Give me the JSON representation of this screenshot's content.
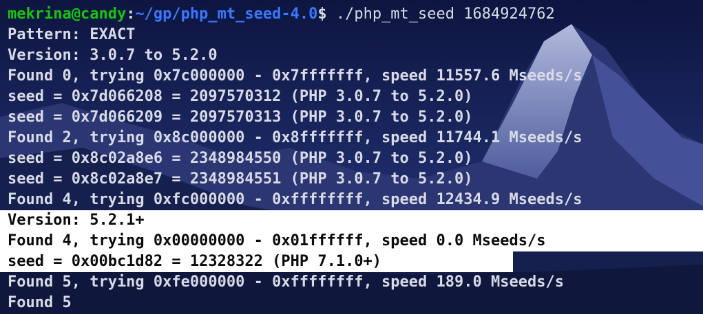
{
  "theme": {
    "background": "#1b2457",
    "text": "#d8dbe6",
    "prompt_user": "#16c60c",
    "prompt_path": "#3b78ff",
    "selection_bg": "#ffffff",
    "selection_text": "#0c0c0c"
  },
  "prompt": {
    "user_host": "mekrina@candy",
    "colon": ":",
    "path": "~/gp/php_mt_seed-4.0",
    "dollar": "$",
    "command": " ./php_mt_seed 1684924762"
  },
  "output": [
    "Pattern: EXACT",
    "Version: 3.0.7 to 5.2.0",
    "Found 0, trying 0x7c000000 - 0x7fffffff, speed 11557.6 Mseeds/s",
    "seed = 0x7d066208 = 2097570312 (PHP 3.0.7 to 5.2.0)",
    "seed = 0x7d066209 = 2097570313 (PHP 3.0.7 to 5.2.0)",
    "Found 2, trying 0x8c000000 - 0x8fffffff, speed 11744.1 Mseeds/s",
    "seed = 0x8c02a8e6 = 2348984550 (PHP 3.0.7 to 5.2.0)",
    "seed = 0x8c02a8e7 = 2348984551 (PHP 3.0.7 to 5.2.0)",
    "Found 4, trying 0xfc000000 - 0xffffffff, speed 12434.9 Mseeds/s",
    "Version: 5.2.1+",
    "Found 4, trying 0x00000000 - 0x01ffffff, speed 0.0 Mseeds/s",
    "seed = 0x00bc1d82 = 12328322 (PHP 7.1.0+)",
    "Found 5, trying 0xfe000000 - 0xffffffff, speed 189.0 Mseeds/s",
    "Found 5"
  ]
}
